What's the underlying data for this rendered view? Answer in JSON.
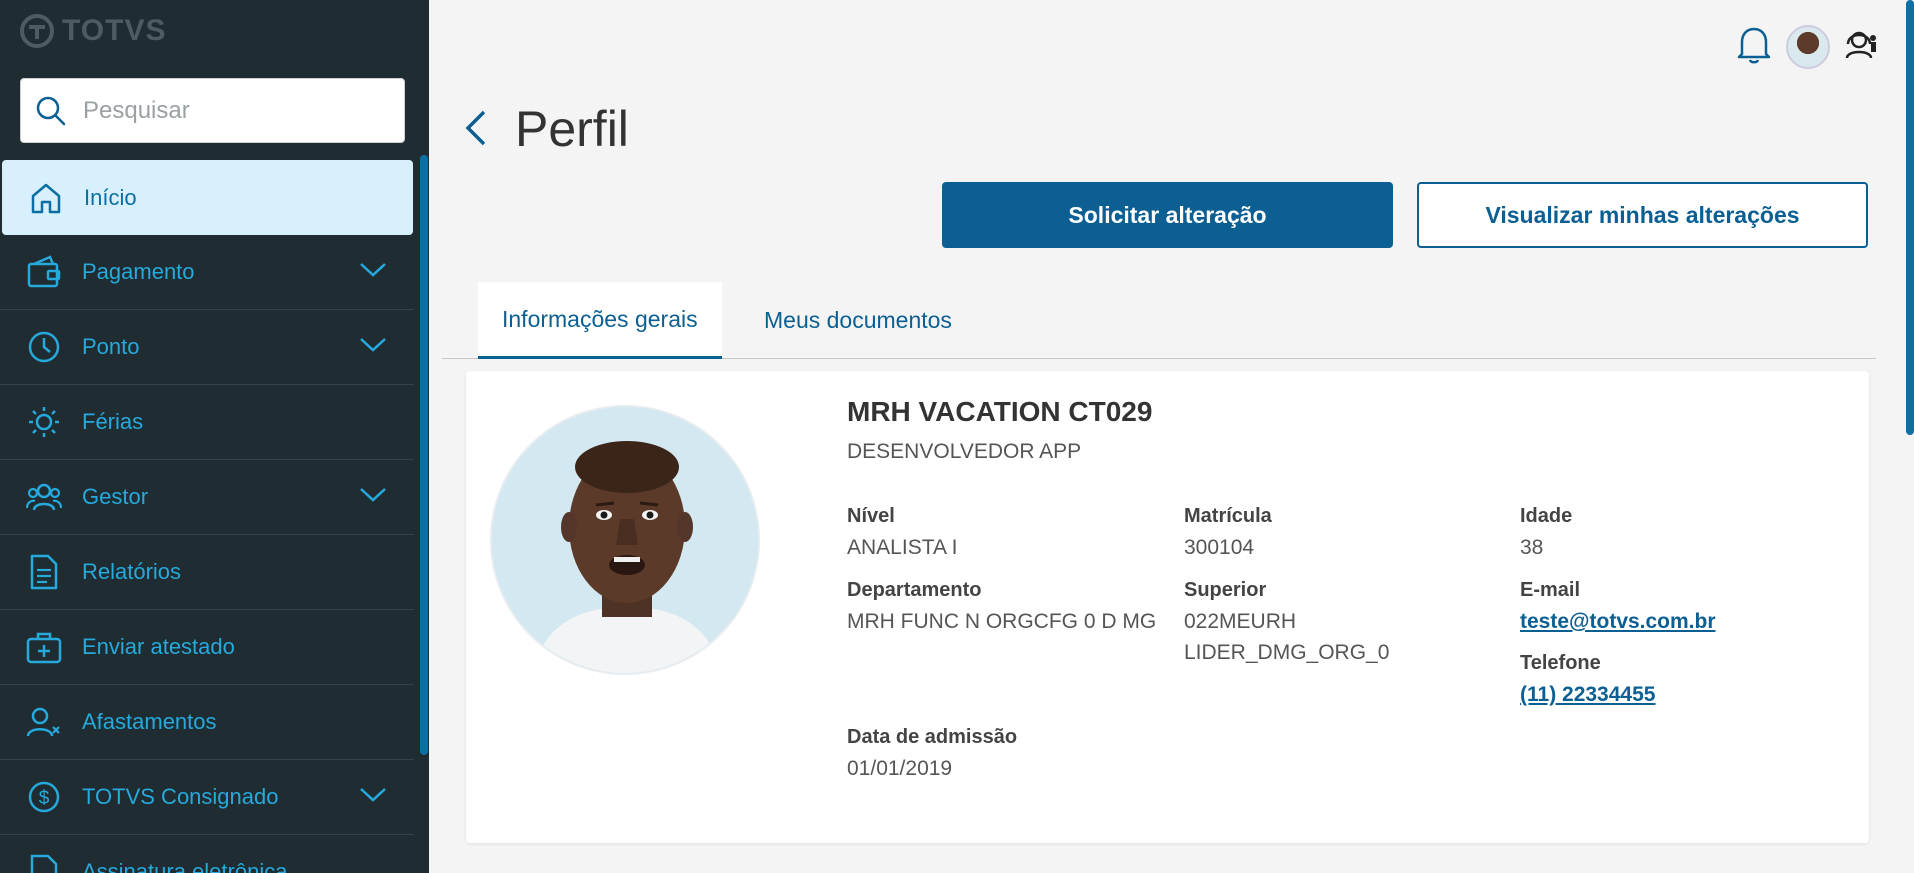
{
  "sidebar": {
    "logo": "TOTVS",
    "search_placeholder": "Pesquisar",
    "items": [
      {
        "label": "Início"
      },
      {
        "label": "Pagamento"
      },
      {
        "label": "Ponto"
      },
      {
        "label": "Férias"
      },
      {
        "label": "Gestor"
      },
      {
        "label": "Relatórios"
      },
      {
        "label": "Enviar atestado"
      },
      {
        "label": "Afastamentos"
      },
      {
        "label": "TOTVS Consignado"
      },
      {
        "label": "Assinatura eletrônica"
      }
    ]
  },
  "header": {
    "title": "Perfil",
    "primary_button": "Solicitar alteração",
    "secondary_button": "Visualizar minhas alterações"
  },
  "tabs": [
    {
      "label": "Informações gerais"
    },
    {
      "label": "Meus documentos"
    }
  ],
  "profile": {
    "name": "MRH VACATION CT029",
    "role": "DESENVOLVEDOR APP",
    "nivel_label": "Nível",
    "nivel": "ANALISTA I",
    "matricula_label": "Matrícula",
    "matricula": "300104",
    "idade_label": "Idade",
    "idade": "38",
    "departamento_label": "Departamento",
    "departamento": "MRH FUNC N ORGCFG 0 D MG",
    "superior_label": "Superior",
    "superior_line1": "022MEURH",
    "superior_line2": "LIDER_DMG_ORG_0",
    "email_label": "E-mail",
    "email": "teste@totvs.com.br",
    "telefone_label": "Telefone",
    "telefone": "(11) 22334455",
    "admissao_label": "Data de admissão",
    "admissao": "01/01/2019"
  },
  "colors": {
    "sidebar_bg": "#1f2c31",
    "accent": "#0b5f93",
    "menu_text": "#26a9dc",
    "active_bg": "#d8f0fb"
  }
}
